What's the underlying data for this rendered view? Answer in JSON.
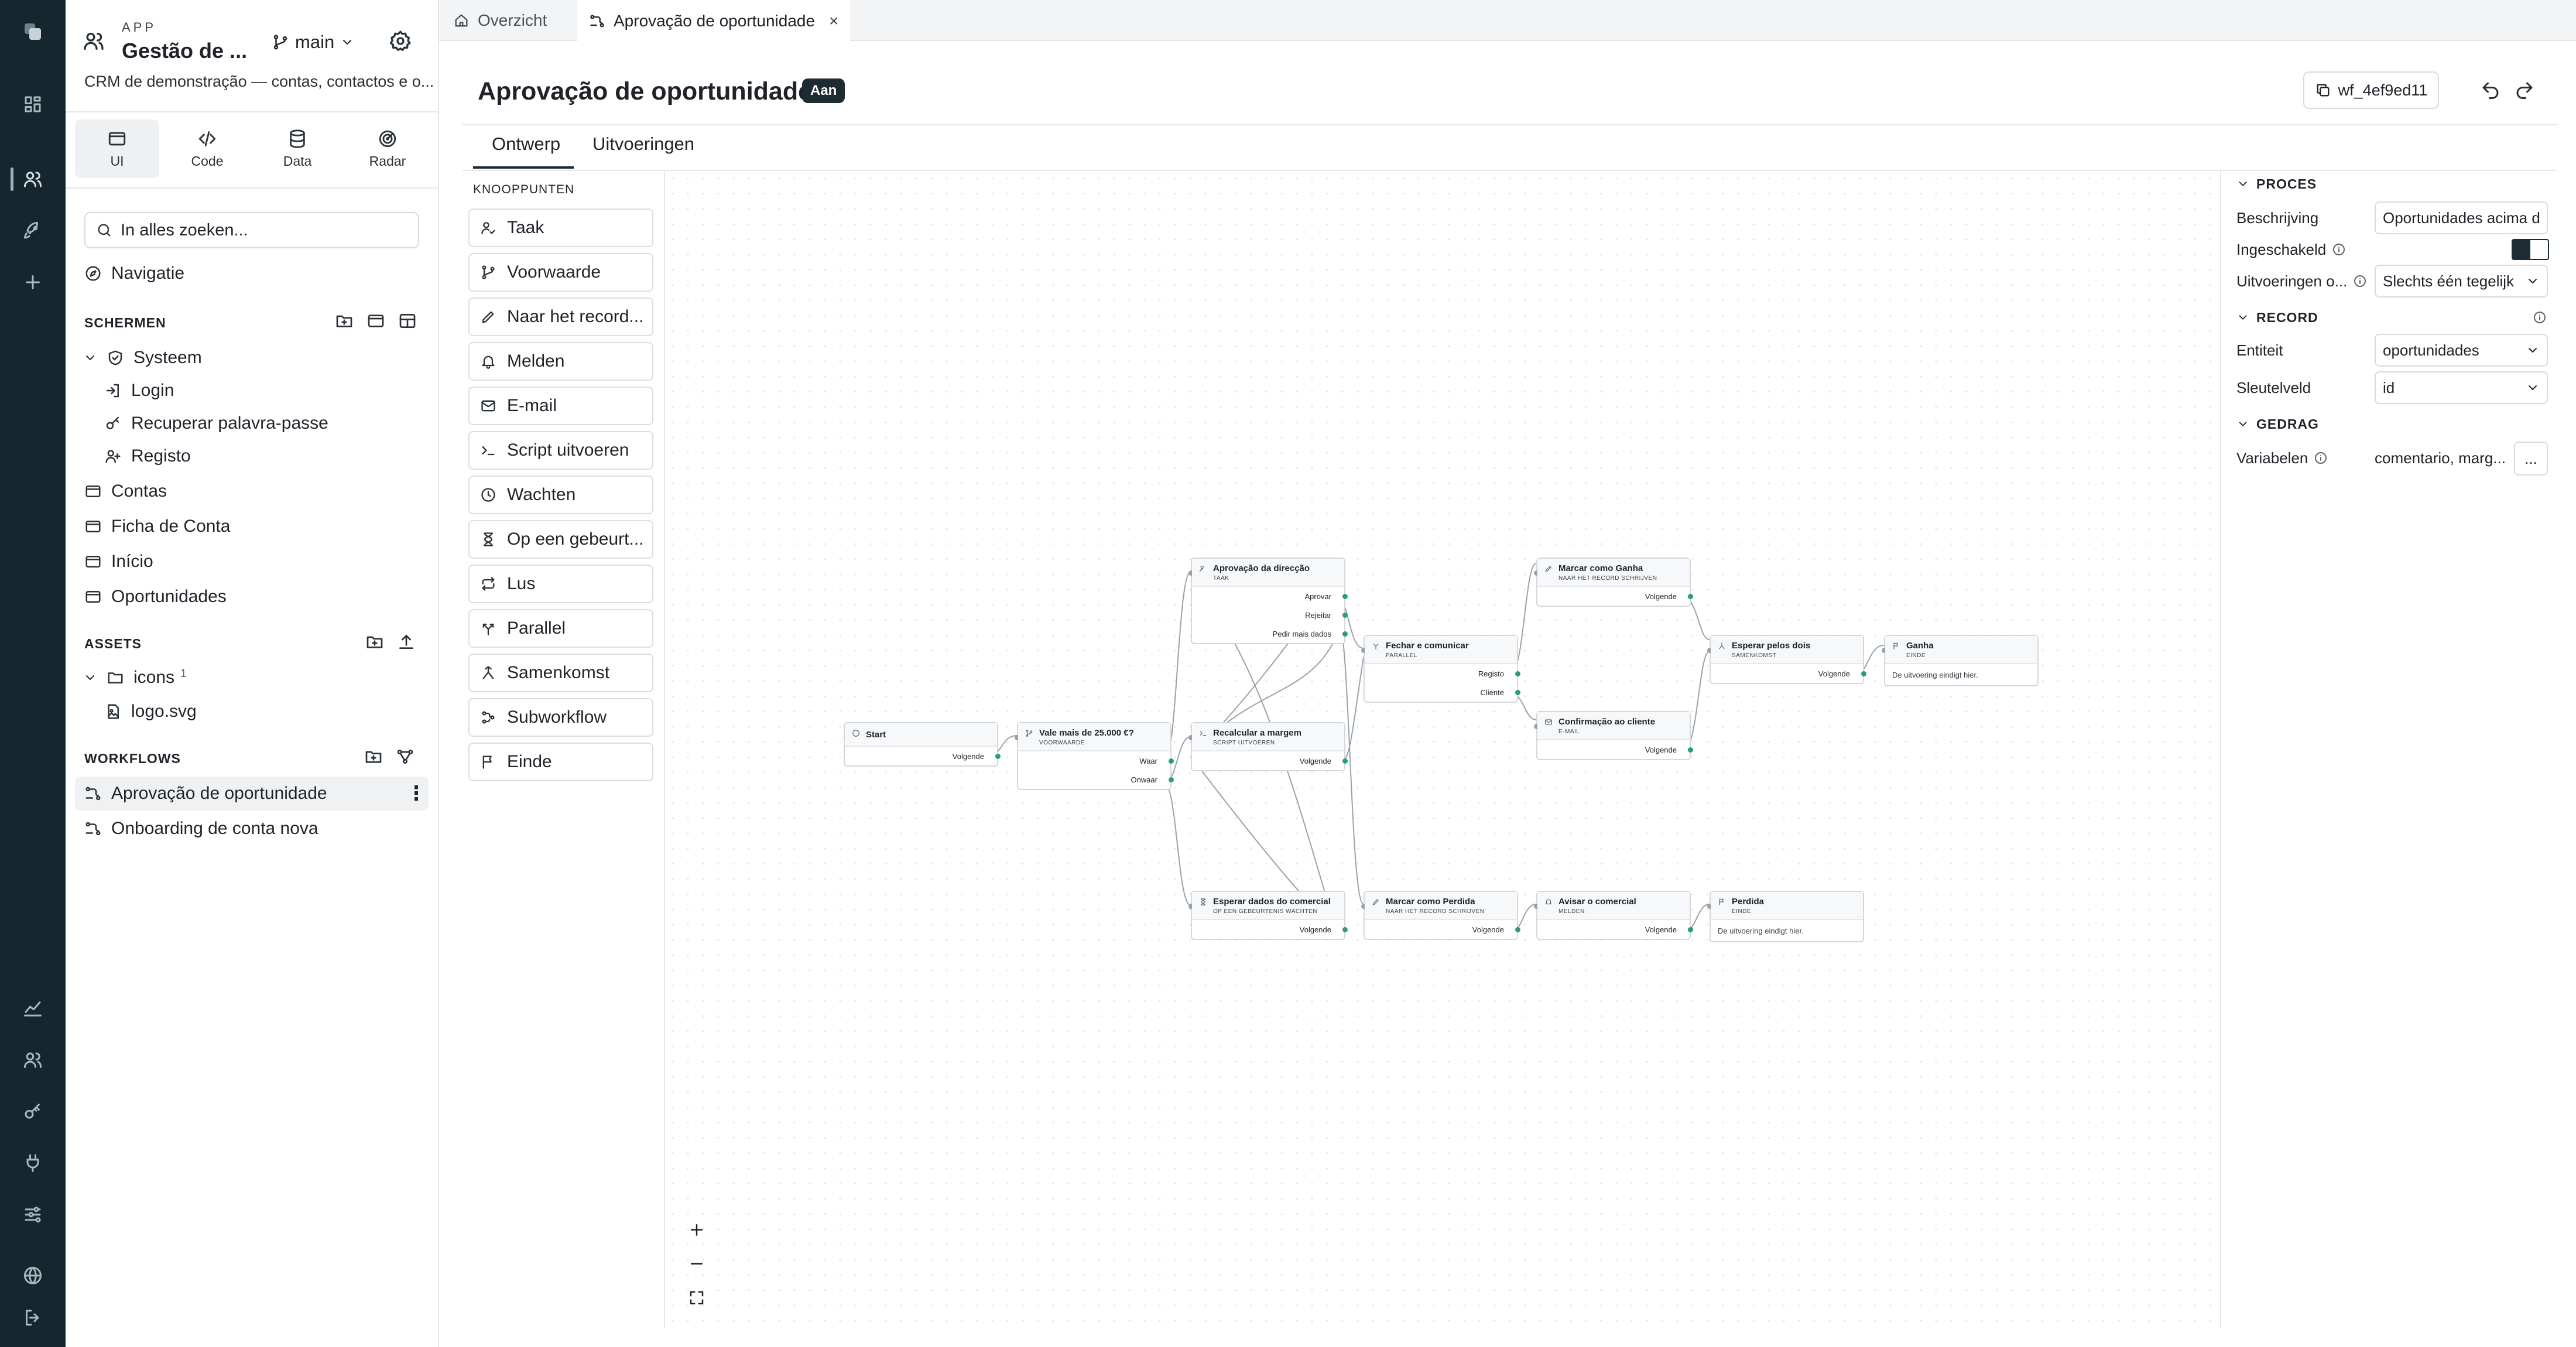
{
  "rail": {
    "icons": [
      "logo-icon",
      "dashboard-icon",
      "users-icon",
      "rocket-icon",
      "add-icon",
      "analytics-icon",
      "team-icon",
      "key-icon",
      "plug-icon",
      "sliders-icon",
      "globe-icon",
      "logout-icon"
    ]
  },
  "app": {
    "kicker": "APP",
    "name": "Gestão de ...",
    "branch": "main",
    "description": "CRM de demonstração — contas, contactos e o..."
  },
  "modes": [
    {
      "label": "UI",
      "icon": "window-icon",
      "active": true
    },
    {
      "label": "Code",
      "icon": "code-icon",
      "active": false
    },
    {
      "label": "Data",
      "icon": "database-icon",
      "active": false
    },
    {
      "label": "Radar",
      "icon": "radar-icon",
      "active": false
    }
  ],
  "search": {
    "placeholder": "In alles zoeken..."
  },
  "navigation_label": "Navigatie",
  "screens": {
    "title": "SCHERMEN",
    "system_folder": "Systeem",
    "system_items": [
      "Login",
      "Recuperar palavra-passe",
      "Registo"
    ],
    "items": [
      "Contas",
      "Ficha de Conta",
      "Início",
      "Oportunidades"
    ]
  },
  "assets": {
    "title": "ASSETS",
    "folder": "icons",
    "folder_count": "1",
    "file": "logo.svg"
  },
  "workflows": {
    "title": "WORKFLOWS",
    "items": [
      "Aprovação de oportunidade",
      "Onboarding de conta nova"
    ]
  },
  "tabs": [
    {
      "label": "Overzicht",
      "active": false
    },
    {
      "label": "Aprovação de oportunidade",
      "active": true,
      "close": "×"
    }
  ],
  "page": {
    "title": "Aprovação de oportunidade",
    "status_badge": "Aan",
    "workflow_id": "wf_4ef9ed11",
    "subtabs": [
      "Ontwerp",
      "Uitvoeringen"
    ]
  },
  "palette": {
    "title": "KNOOPPUNTEN",
    "items": [
      {
        "label": "Taak",
        "icon": "user-task-icon"
      },
      {
        "label": "Voorwaarde",
        "icon": "branch-icon"
      },
      {
        "label": "Naar het record...",
        "icon": "pencil-icon"
      },
      {
        "label": "Melden",
        "icon": "bell-icon"
      },
      {
        "label": "E-mail",
        "icon": "mail-icon"
      },
      {
        "label": "Script uitvoeren",
        "icon": "terminal-icon"
      },
      {
        "label": "Wachten",
        "icon": "clock-icon"
      },
      {
        "label": "Op een gebeurt...",
        "icon": "hourglass-icon"
      },
      {
        "label": "Lus",
        "icon": "loop-icon"
      },
      {
        "label": "Parallel",
        "icon": "split-icon"
      },
      {
        "label": "Samenkomst",
        "icon": "merge-icon"
      },
      {
        "label": "Subworkflow",
        "icon": "subflow-icon"
      },
      {
        "label": "Einde",
        "icon": "flag-icon"
      }
    ]
  },
  "graph": {
    "nodes": [
      {
        "id": "start",
        "title": "Start",
        "outputs": [
          "Volgende"
        ]
      },
      {
        "id": "vale",
        "title": "Vale mais de 25.000 €?",
        "subtitle": "VOORWAARDE",
        "outputs": [
          "Waar",
          "Onwaar"
        ]
      },
      {
        "id": "aprov",
        "title": "Aprovação da direcção",
        "subtitle": "TAAK",
        "outputs": [
          "Aprovar",
          "Rejeitar",
          "Pedir mais dados"
        ]
      },
      {
        "id": "recalc",
        "title": "Recalcular a margem",
        "subtitle": "SCRIPT UITVOEREN",
        "outputs": [
          "Volgende"
        ]
      },
      {
        "id": "esperar",
        "title": "Esperar dados do comercial",
        "subtitle": "OP EEN GEBEURTENIS WACHTEN",
        "outputs": [
          "Volgende"
        ]
      },
      {
        "id": "fechar",
        "title": "Fechar e comunicar",
        "subtitle": "PARALLEL",
        "outputs": [
          "Registo",
          "Cliente"
        ]
      },
      {
        "id": "perdida_mark",
        "title": "Marcar como Perdida",
        "subtitle": "NAAR HET RECORD SCHRIJVEN",
        "outputs": [
          "Volgende"
        ]
      },
      {
        "id": "ganha_mark",
        "title": "Marcar como Ganha",
        "subtitle": "NAAR HET RECORD SCHRIJVEN",
        "outputs": [
          "Volgende"
        ]
      },
      {
        "id": "confirm",
        "title": "Confirmação ao cliente",
        "subtitle": "E-MAIL",
        "outputs": [
          "Volgende"
        ]
      },
      {
        "id": "avisar",
        "title": "Avisar o comercial",
        "subtitle": "MELDEN",
        "outputs": [
          "Volgende"
        ]
      },
      {
        "id": "esperar_dois",
        "title": "Esperar pelos dois",
        "subtitle": "SAMENKOMST",
        "outputs": [
          "Volgende"
        ]
      },
      {
        "id": "ganha",
        "title": "Ganha",
        "subtitle": "EINDE",
        "note": "De uitvoering eindigt hier."
      },
      {
        "id": "perdida",
        "title": "Perdida",
        "subtitle": "EINDE",
        "note": "De uitvoering eindigt hier."
      }
    ]
  },
  "properties": {
    "proces": {
      "title": "PROCES",
      "description_label": "Beschrijving",
      "description_value": "Oportunidades acima de",
      "enabled_label": "Ingeschakeld",
      "runs_label": "Uitvoeringen o...",
      "runs_value": "Slechts één tegelijk"
    },
    "record": {
      "title": "RECORD",
      "entity_label": "Entiteit",
      "entity_value": "oportunidades",
      "key_label": "Sleutelveld",
      "key_value": "id"
    },
    "gedrag": {
      "title": "GEDRAG",
      "vars_label": "Variabelen",
      "vars_value": "comentario, marg...",
      "more": "..."
    }
  }
}
